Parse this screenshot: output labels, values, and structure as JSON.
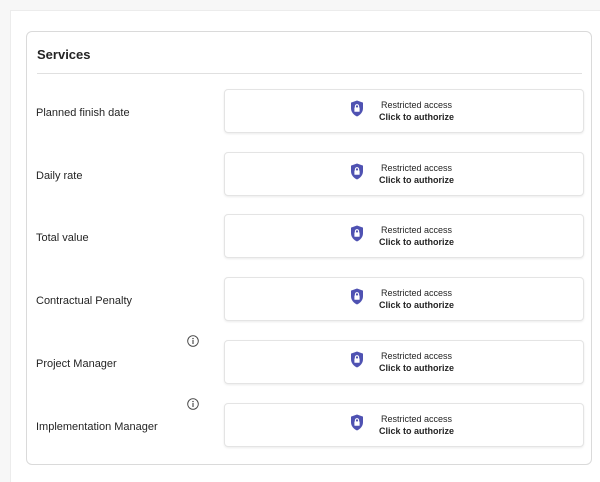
{
  "section": {
    "title": "Services"
  },
  "restricted": {
    "line1": "Restricted access",
    "line2": "Click to authorize",
    "accent_color": "#4f52b2"
  },
  "fields": [
    {
      "label": "Planned finish date",
      "has_info": false
    },
    {
      "label": "Daily rate",
      "has_info": false
    },
    {
      "label": "Total value",
      "has_info": false
    },
    {
      "label": "Contractual Penalty",
      "has_info": false
    },
    {
      "label": "Project Manager",
      "has_info": true
    },
    {
      "label": "Implementation Manager",
      "has_info": true
    }
  ]
}
